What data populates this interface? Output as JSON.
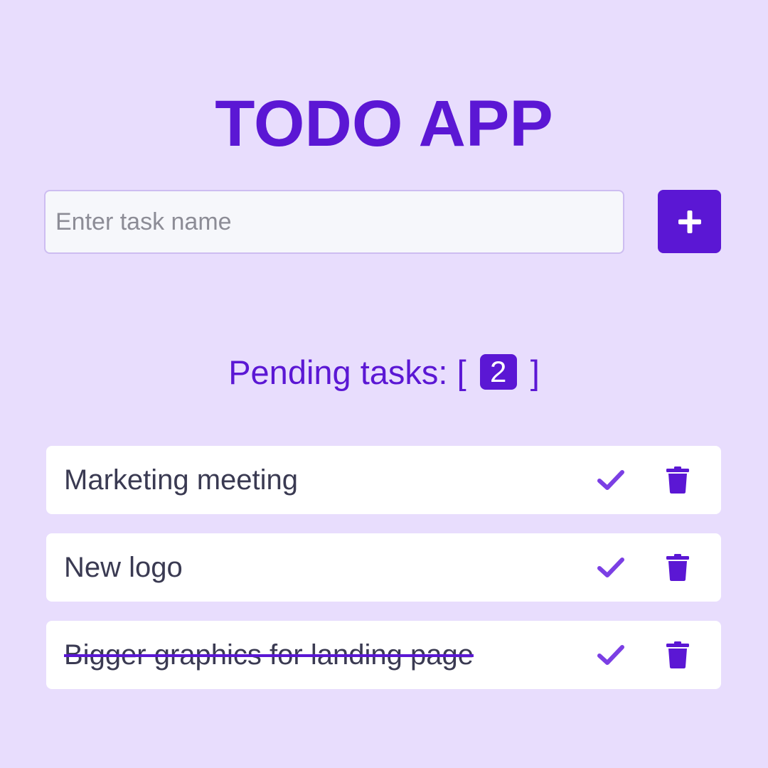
{
  "app": {
    "title": "TODO APP"
  },
  "input": {
    "placeholder": "Enter task name",
    "value": ""
  },
  "add_button": {
    "icon": "plus-icon",
    "label": "+"
  },
  "pending": {
    "label": "Pending tasks:",
    "open_bracket": "[",
    "count": "2",
    "close_bracket": "]"
  },
  "tasks": [
    {
      "name": "Marketing meeting",
      "completed": false
    },
    {
      "name": "New logo",
      "completed": false
    },
    {
      "name": "Bigger graphics for landing page",
      "completed": true
    }
  ],
  "icons": {
    "complete": "check-icon",
    "delete": "trash-icon"
  },
  "colors": {
    "background": "#e8ddfd",
    "accent": "#5b17d4",
    "check": "#7b3fe4",
    "card": "#ffffff",
    "text": "#3a3a52"
  }
}
